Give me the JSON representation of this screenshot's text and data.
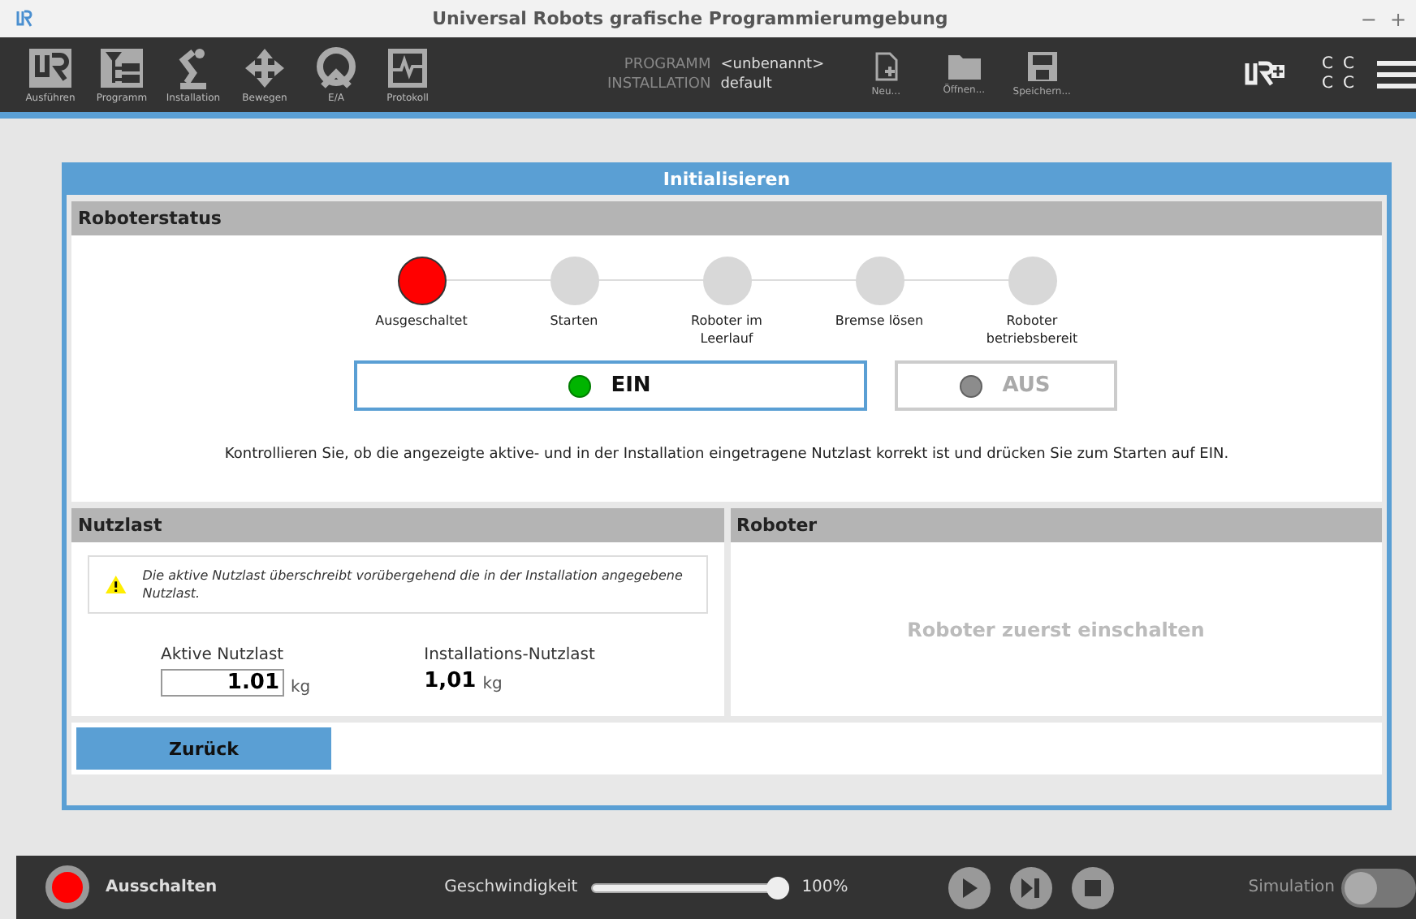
{
  "window": {
    "title": "Universal Robots grafische Programmierumgebung",
    "controls": [
      "−",
      "+"
    ]
  },
  "toolbar": {
    "tabs": [
      {
        "label": "Ausführen",
        "kind": "run"
      },
      {
        "label": "Programm",
        "kind": "program"
      },
      {
        "label": "Installation",
        "kind": "installation"
      },
      {
        "label": "Bewegen",
        "kind": "move"
      },
      {
        "label": "E/A",
        "kind": "io"
      },
      {
        "label": "Protokoll",
        "kind": "log"
      }
    ],
    "program_label": "PROGRAMM",
    "program_value": "<unbenannt>",
    "installation_label": "INSTALLATION",
    "installation_value": "default",
    "file_buttons": [
      {
        "label": "Neu...",
        "kind": "new"
      },
      {
        "label": "Öffnen...",
        "kind": "open"
      },
      {
        "label": "Speichern...",
        "kind": "save"
      }
    ],
    "cc": [
      "C",
      "C",
      "C",
      "C"
    ]
  },
  "dialog": {
    "title": "Initialisieren",
    "status": {
      "title": "Roboterstatus",
      "steps": [
        {
          "label": "Ausgeschaltet",
          "selected": true
        },
        {
          "label": "Starten",
          "selected": false
        },
        {
          "label": "Roboter im Leerlauf",
          "selected": false
        },
        {
          "label": "Bremse lösen",
          "selected": false
        },
        {
          "label": "Roboter betriebsbereit",
          "selected": false
        }
      ],
      "buttons": [
        {
          "label": "EIN",
          "selected": true,
          "disabled": false,
          "color": "#00b400"
        },
        {
          "label": "AUS",
          "selected": false,
          "disabled": true,
          "color": "#8c8c8c"
        }
      ],
      "hint": "Kontrollieren Sie, ob die angezeigte aktive- und in der Installation eingetragene Nutzlast korrekt ist und drücken Sie zum Starten auf EIN."
    },
    "payload": {
      "title": "Nutzlast",
      "warning": "Die aktive Nutzlast überschreibt vorübergehend die in der Installation angegebene Nutzlast.",
      "active_label": "Aktive Nutzlast",
      "active_value": "1.01",
      "active_unit": "kg",
      "installed_label": "Installations-Nutzlast",
      "installed_value": "1,01",
      "installed_unit": "kg"
    },
    "robot": {
      "title": "Roboter",
      "message": "Roboter zuerst einschalten"
    },
    "back_button": "Zurück"
  },
  "footer": {
    "power_label": "Ausschalten",
    "speed_label": "Geschwindigkeit",
    "speed": {
      "level": 1
    },
    "speed_reading": "100%",
    "simulation_label": "Simulation",
    "simulation_on": false
  }
}
